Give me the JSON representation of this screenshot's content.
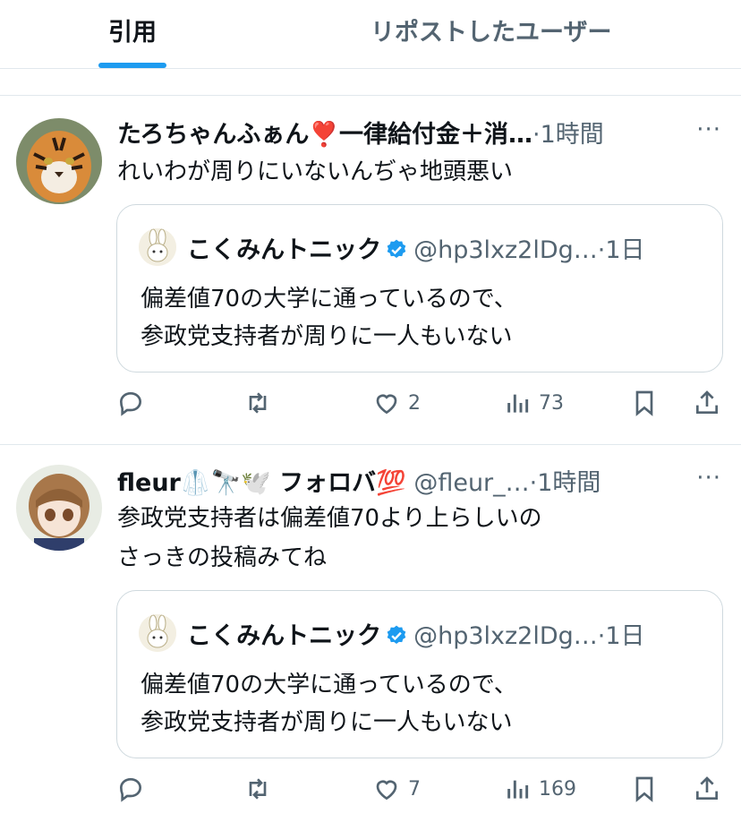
{
  "tabs": [
    {
      "label": "引用",
      "active": true
    },
    {
      "label": "リポストしたユーザー",
      "active": false
    }
  ],
  "colors": {
    "accent": "#1d9bf0",
    "secondary_text": "#536471",
    "border": "#cfd9de"
  },
  "tweets": [
    {
      "display_name": "たろちゃんふぁん❣️一律給付金＋消…",
      "time_meta": "·1時間",
      "more": "···",
      "text_lines": [
        "れいわが周りにいないんぢゃ地頭悪い"
      ],
      "avatar_icon": "tiger-avatar-icon",
      "quote": {
        "display_name": "こくみんトニック",
        "handle": "@hp3lxz2lDg…",
        "time_meta": "·1日",
        "text_lines": [
          "偏差値70の大学に通っているので、",
          "参政党支持者が周りに一人もいない"
        ]
      },
      "stats": {
        "replies": "",
        "reposts": "",
        "likes": "2",
        "views": "73"
      }
    },
    {
      "display_name": "fleur🥼🔭🕊️ フォロバ💯",
      "handle": "@fleur_…",
      "time_meta": "·1時間",
      "more": "···",
      "text_lines": [
        "参政党支持者は偏差値70より上らしいの",
        "さっきの投稿みてね"
      ],
      "avatar_icon": "doll-avatar-icon",
      "quote": {
        "display_name": "こくみんトニック",
        "handle": "@hp3lxz2lDg…",
        "time_meta": "·1日",
        "text_lines": [
          "偏差値70の大学に通っているので、",
          "参政党支持者が周りに一人もいない"
        ]
      },
      "stats": {
        "replies": "",
        "reposts": "",
        "likes": "7",
        "views": "169"
      }
    }
  ]
}
